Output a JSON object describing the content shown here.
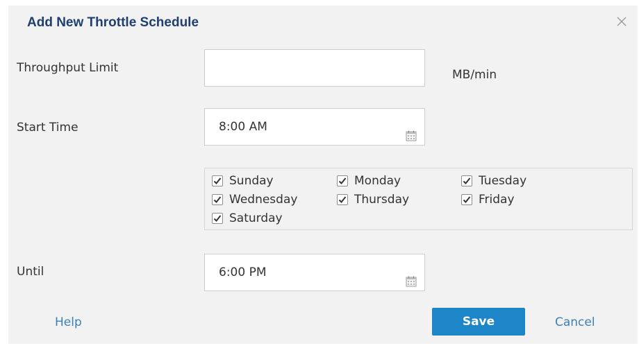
{
  "dialog": {
    "title": "Add New Throttle Schedule",
    "close_icon": "close-icon"
  },
  "throughput": {
    "label": "Throughput Limit",
    "value": "",
    "unit": "MB/min"
  },
  "start_time": {
    "label": "Start Time",
    "value": "8:00 AM",
    "icon": "calendar-icon"
  },
  "days": [
    {
      "label": "Sunday",
      "checked": true
    },
    {
      "label": "Monday",
      "checked": true
    },
    {
      "label": "Tuesday",
      "checked": true
    },
    {
      "label": "Wednesday",
      "checked": true
    },
    {
      "label": "Thursday",
      "checked": true
    },
    {
      "label": "Friday",
      "checked": true
    },
    {
      "label": "Saturday",
      "checked": true
    }
  ],
  "until": {
    "label": "Until",
    "value": "6:00 PM",
    "icon": "calendar-icon"
  },
  "footer": {
    "help": "Help",
    "save": "Save",
    "cancel": "Cancel"
  },
  "colors": {
    "title": "#1f3f6e",
    "accent": "#1d86c8",
    "link": "#3b7fb6",
    "dialog_bg": "#f2f2f2"
  }
}
